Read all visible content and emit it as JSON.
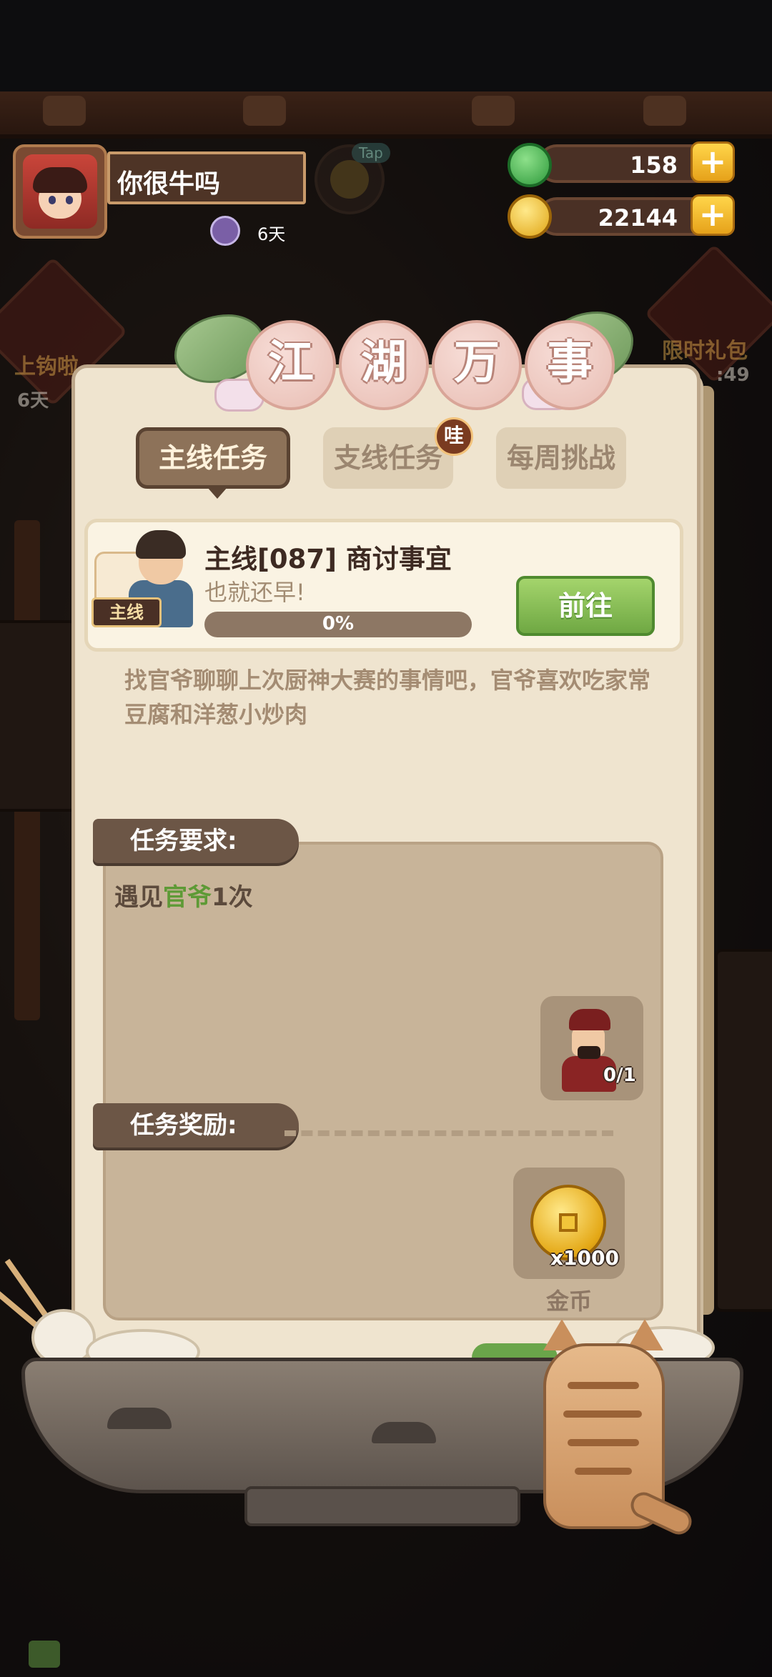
{
  "hud": {
    "player_name": "你很牛吗",
    "tap_label": "Tap",
    "days": "6天",
    "gems": "158",
    "coins": "22144",
    "plus": "+"
  },
  "side": {
    "left_text": "上钩啦",
    "left_sub": "6天",
    "right_text": "限时礼包",
    "right_sub": ":49"
  },
  "panel": {
    "title_chars": [
      "江",
      "湖",
      "万",
      "事"
    ],
    "tabs": [
      {
        "label": "主线任务",
        "active": true
      },
      {
        "label": "支线任务",
        "active": false,
        "badge": "哇"
      },
      {
        "label": "每周挑战",
        "active": false
      }
    ]
  },
  "quest": {
    "tag": "主线",
    "title": "主线[087] 商讨事宜",
    "subtitle": "也就还早!",
    "progress_value": 0,
    "progress_text": "0%",
    "go_label": "前往",
    "description": "找官爷聊聊上次厨神大赛的事情吧，官爷喜欢吃家常豆腐和洋葱小炒肉"
  },
  "requirements": {
    "header": "任务要求:",
    "prefix": "遇见",
    "highlight": "官爷",
    "suffix": "1次",
    "npc_count": "0/1"
  },
  "rewards": {
    "header": "任务奖励:",
    "amount": "x1000",
    "name": "金币"
  },
  "colors": {
    "accent_green": "#7fb45a",
    "panel_bg": "#efe4cf",
    "tab_active": "#8d7259",
    "highlight_green": "#5e9a36"
  }
}
